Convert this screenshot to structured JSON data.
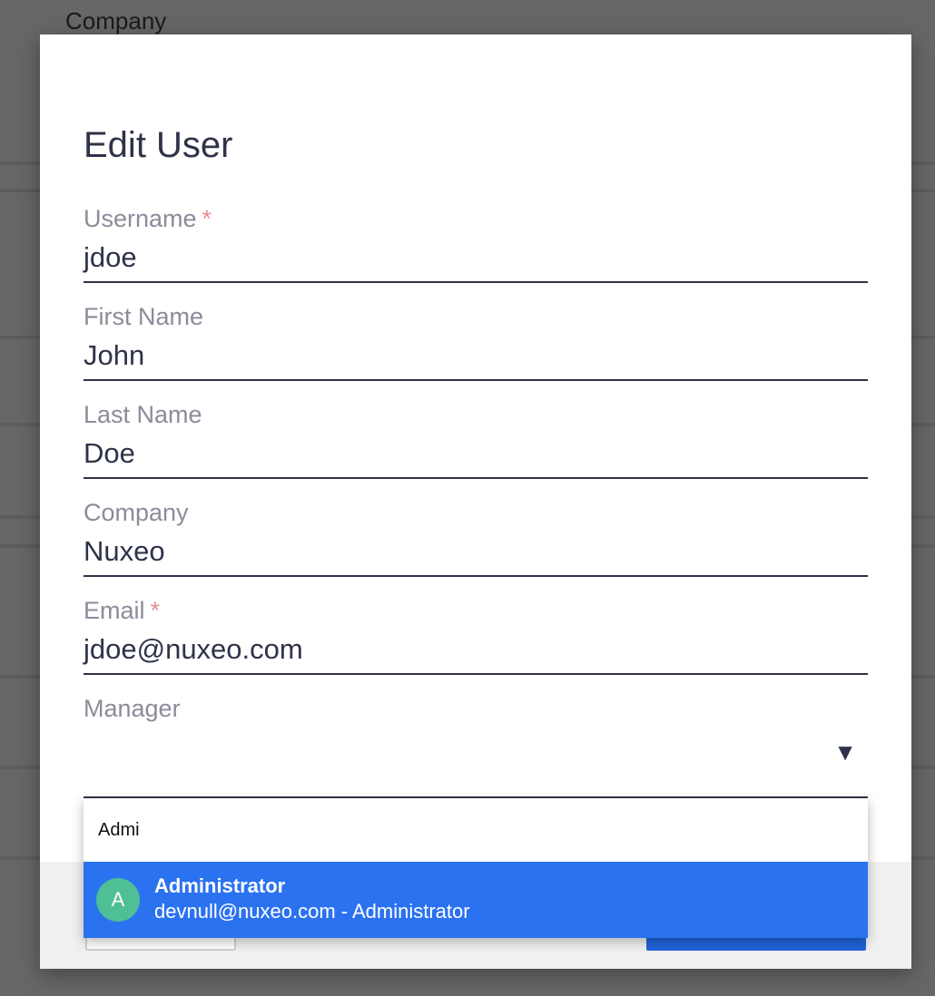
{
  "background": {
    "title": "Company"
  },
  "dialog": {
    "title": "Edit User",
    "required_marker": "*",
    "fields": {
      "username": {
        "label": "Username",
        "value": "jdoe",
        "required": true
      },
      "first_name": {
        "label": "First Name",
        "value": "John",
        "required": false
      },
      "last_name": {
        "label": "Last Name",
        "value": "Doe",
        "required": false
      },
      "company": {
        "label": "Company",
        "value": "Nuxeo",
        "required": false
      },
      "email": {
        "label": "Email",
        "value": "jdoe@nuxeo.com",
        "required": true
      },
      "manager": {
        "label": "Manager",
        "value": "",
        "arrow": "▼"
      }
    }
  },
  "manager_dropdown": {
    "search_value": "Admi",
    "options": [
      {
        "initial": "A",
        "name": "Administrator",
        "subtitle": "devnull@nuxeo.com - Administrator"
      }
    ]
  },
  "colors": {
    "accent": "#2b72f0",
    "primary_button": "#1f63d8",
    "avatar": "#4fbf96",
    "required": "#e88f8f",
    "text": "#2f3349"
  }
}
